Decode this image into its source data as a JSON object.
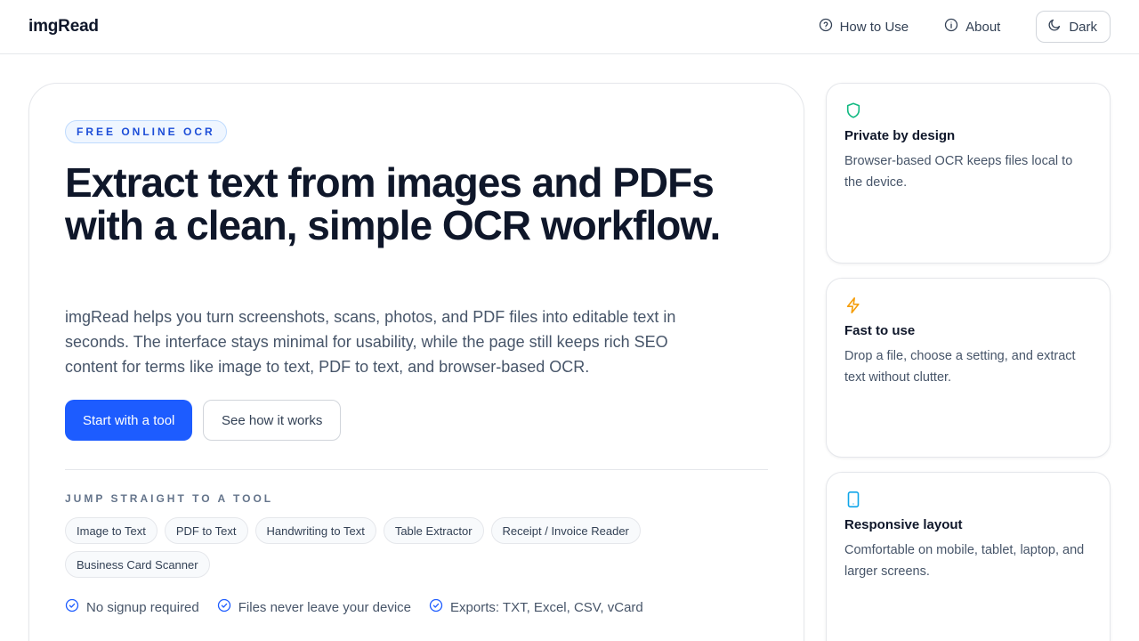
{
  "header": {
    "brand": "imgRead",
    "nav": [
      {
        "label": "How to Use",
        "icon": "question-circle-icon"
      },
      {
        "label": "About",
        "icon": "info-circle-icon"
      }
    ],
    "theme_toggle": {
      "label": "Dark",
      "icon": "moon-icon"
    }
  },
  "hero": {
    "badge": "FREE ONLINE OCR",
    "title": "Extract text from images and PDFs with a clean, simple OCR workflow.",
    "description": "imgRead helps you turn screenshots, scans, photos, and PDF files into editable text in seconds. The interface stays minimal for usability, while the page still keeps rich SEO content for terms like image to text, PDF to text, and browser-based OCR.",
    "primary_button": "Start with a tool",
    "secondary_button": "See how it works",
    "jump_label": "JUMP STRAIGHT TO A TOOL",
    "tools": [
      "Image to Text",
      "PDF to Text",
      "Handwriting to Text",
      "Table Extractor",
      "Receipt / Invoice Reader",
      "Business Card Scanner"
    ],
    "features": [
      "No signup required",
      "Files never leave your device",
      "Exports: TXT, Excel, CSV, vCard"
    ]
  },
  "side_cards": [
    {
      "icon": "shield-icon",
      "title": "Private by design",
      "text": "Browser-based OCR keeps files local to the device.",
      "color": "#10b981"
    },
    {
      "icon": "lightning-icon",
      "title": "Fast to use",
      "text": "Drop a file, choose a setting, and extract text without clutter.",
      "color": "#f59e0b"
    },
    {
      "icon": "tablet-icon",
      "title": "Responsive layout",
      "text": "Comfortable on mobile, tablet, laptop, and larger screens.",
      "color": "#0ea5e9"
    }
  ],
  "colors": {
    "accent": "#1d5cff",
    "badge_text": "#1d4ed8",
    "check": "#1d5cff"
  }
}
